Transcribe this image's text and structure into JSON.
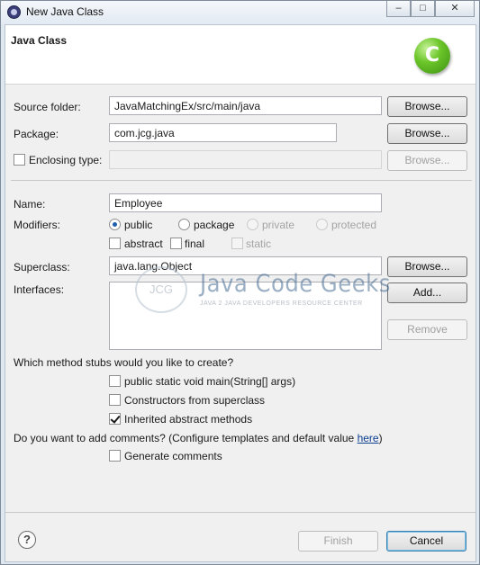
{
  "window": {
    "title": "New Java Class",
    "controls": {
      "minimize": "–",
      "maximize": "□",
      "close": "✕"
    }
  },
  "banner": {
    "title": "Java Class",
    "icon": "java-class-wizard-icon",
    "icon_glyph": "C"
  },
  "form": {
    "source_folder": {
      "label": "Source folder:",
      "value": "JavaMatchingEx/src/main/java",
      "browse": "Browse..."
    },
    "package": {
      "label": "Package:",
      "value": "com.jcg.java",
      "browse": "Browse..."
    },
    "enclosing_type": {
      "label": "Enclosing type:",
      "checked": false,
      "value": "",
      "browse": "Browse..."
    },
    "name": {
      "label": "Name:",
      "value": "Employee"
    },
    "modifiers": {
      "label": "Modifiers:",
      "access": [
        {
          "label": "public",
          "selected": true,
          "enabled": true
        },
        {
          "label": "package",
          "selected": false,
          "enabled": true
        },
        {
          "label": "private",
          "selected": false,
          "enabled": false
        },
        {
          "label": "protected",
          "selected": false,
          "enabled": false
        }
      ],
      "flags": [
        {
          "label": "abstract",
          "checked": false,
          "enabled": true
        },
        {
          "label": "final",
          "checked": false,
          "enabled": true
        },
        {
          "label": "static",
          "checked": false,
          "enabled": false
        }
      ]
    },
    "superclass": {
      "label": "Superclass:",
      "value": "java.lang.Object",
      "browse": "Browse..."
    },
    "interfaces": {
      "label": "Interfaces:",
      "add": "Add...",
      "remove": "Remove"
    },
    "stubs": {
      "question": "Which method stubs would you like to create?",
      "options": [
        {
          "label": "public static void main(String[] args)",
          "checked": false
        },
        {
          "label": "Constructors from superclass",
          "checked": false
        },
        {
          "label": "Inherited abstract methods",
          "checked": true
        }
      ]
    },
    "comments": {
      "question_prefix": "Do you want to add comments? (Configure templates and default value ",
      "link": "here",
      "question_suffix": ")",
      "option": {
        "label": "Generate comments",
        "checked": false
      }
    }
  },
  "watermark": {
    "logo": "JCG",
    "title": "Java Code Geeks",
    "subtitle": "JAVA 2 JAVA DEVELOPERS RESOURCE CENTER"
  },
  "footer": {
    "help_icon": "help-icon",
    "help_glyph": "?",
    "finish": "Finish",
    "cancel": "Cancel"
  }
}
